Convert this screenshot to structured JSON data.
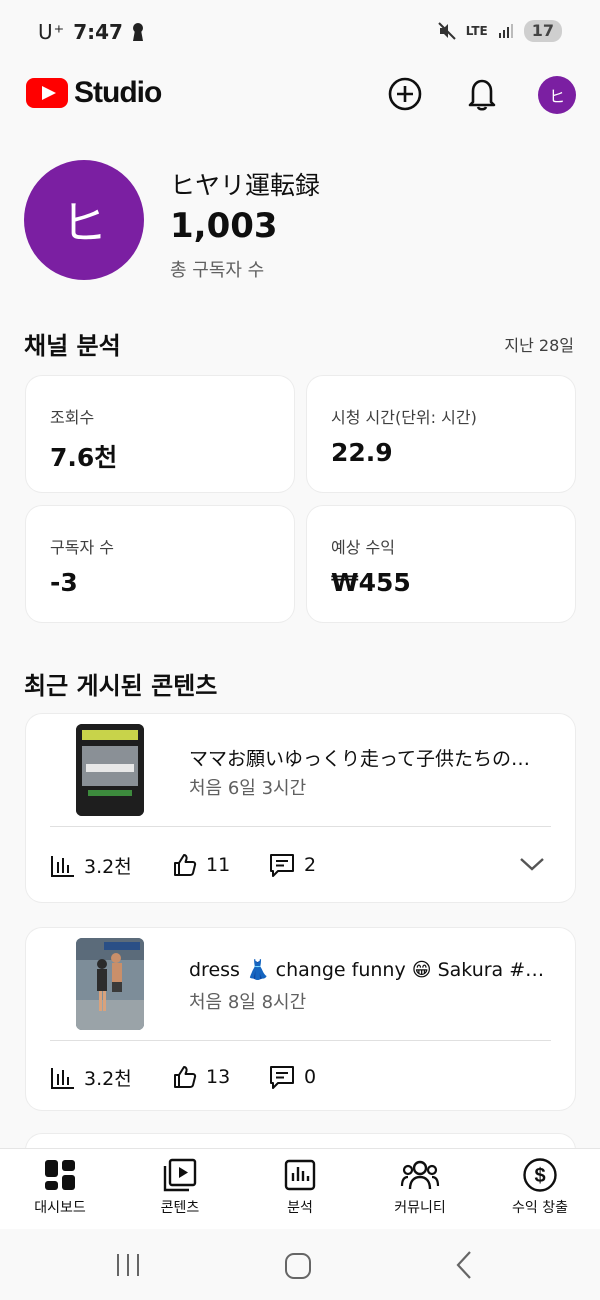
{
  "status_bar": {
    "carrier": "U⁺",
    "time": "7:47",
    "network": "LTE",
    "battery": "17"
  },
  "header": {
    "logo_text": "Studio",
    "avatar_letter": "ヒ"
  },
  "channel": {
    "avatar_letter": "ヒ",
    "name": "ヒヤリ運転録",
    "subscribers": "1,003",
    "subscribers_label": "총 구독자 수"
  },
  "analytics": {
    "title": "채널 분석",
    "period": "지난 28일",
    "metrics": [
      {
        "label": "조회수",
        "value": "7.6천"
      },
      {
        "label": "시청 시간(단위: 시간)",
        "value": "22.9"
      },
      {
        "label": "구독자 수",
        "value": "-3"
      },
      {
        "label": "예상 수익",
        "value": "₩455"
      }
    ]
  },
  "recent": {
    "title": "최근 게시된 콘텐츠",
    "items": [
      {
        "title": "ママお願いゆっくり走って子供たちの…",
        "meta": "처음 6일 3시간",
        "views": "3.2천",
        "likes": "11",
        "comments": "2"
      },
      {
        "title": "dress 👗 change funny 😁 Sakura #…",
        "meta": "처음 8일 8시간",
        "views": "3.2천",
        "likes": "13",
        "comments": "0"
      }
    ]
  },
  "bottom_nav": [
    {
      "label": "대시보드",
      "icon": "dashboard-icon"
    },
    {
      "label": "콘텐츠",
      "icon": "content-icon"
    },
    {
      "label": "분석",
      "icon": "analytics-icon"
    },
    {
      "label": "커뮤니티",
      "icon": "community-icon"
    },
    {
      "label": "수익 창출",
      "icon": "earn-icon"
    }
  ],
  "colors": {
    "brand_red": "#ff0000",
    "avatar_purple": "#7b1fa2"
  }
}
